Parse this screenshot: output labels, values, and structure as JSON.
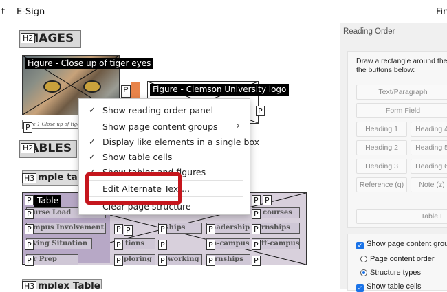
{
  "menubar": {
    "left_item": "t",
    "esign": "E-Sign",
    "right_item": "Fin"
  },
  "document": {
    "h_images": {
      "tag": "H2",
      "text": "IMAGES"
    },
    "figure1": {
      "label": "Figure - Close up of tiger eyes",
      "tag": "Fi"
    },
    "figure2": {
      "label": "Figure - Clemson University logo",
      "tag": "Fi"
    },
    "caption": {
      "tag": "P",
      "text": "igure 1 Close up of tiger e"
    },
    "h_tables": {
      "tag": "H2",
      "text": "TABLES"
    },
    "h_simple": {
      "tag": "H3",
      "text": "mple table"
    },
    "table_label": "Table",
    "row_labels": [
      "urse Load",
      "mpus Involvement",
      "ving Situation",
      "r Prep"
    ],
    "cell_texts": [
      "courses",
      "ships",
      "eadership",
      "rnships",
      "tions",
      "n-campus",
      "ff-campus",
      "ploring",
      "working",
      "rnships"
    ],
    "h_complex": {
      "tag": "H3",
      "text": "mplex Table"
    },
    "p_tag": "P"
  },
  "context_menu": {
    "items": [
      {
        "label": "Show reading order panel",
        "checked": true
      },
      {
        "label": "Show page content groups",
        "checked": false,
        "submenu": true
      },
      {
        "label": "Display like elements in a single box",
        "checked": true
      },
      {
        "label": "Show table cells",
        "checked": true
      },
      {
        "label": "Show tables and figures",
        "checked": true
      },
      {
        "label": "Edit Alternate Text...",
        "checked": false
      },
      {
        "label": "Clear page structure",
        "checked": false
      }
    ]
  },
  "panel": {
    "title": "Reading Order",
    "instructions_line1": "Draw a rectangle around the co",
    "instructions_line2": "the buttons below:",
    "buttons": {
      "text_paragraph": "Text/Paragraph",
      "form_field": "Form Field",
      "heading1": "Heading 1",
      "heading4": "Heading 4",
      "heading2": "Heading 2",
      "heading5": "Heading 5",
      "heading3": "Heading 3",
      "heading6": "Heading 6",
      "reference": "Reference (q)",
      "note": "Note (z)",
      "table_editor": "Table E"
    },
    "options": {
      "show_page_content_groups": "Show page content groups",
      "page_content_order": "Page content order",
      "structure_types": "Structure types",
      "show_table_cells": "Show table cells"
    }
  },
  "colors": {
    "highlight": "#c5161d",
    "accent": "#1a73e8"
  }
}
